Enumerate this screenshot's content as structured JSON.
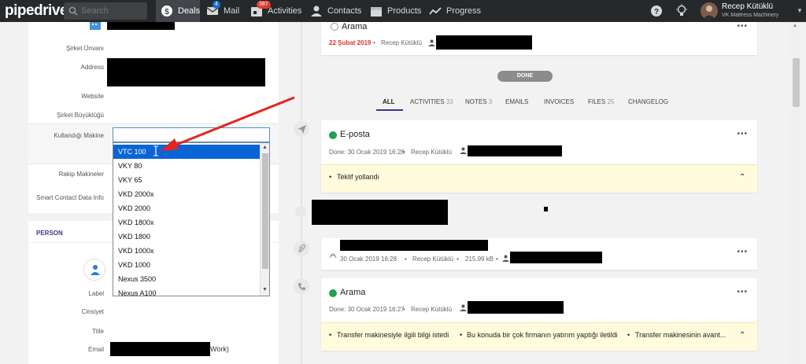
{
  "topbar": {
    "logo": "pipedrive",
    "search_placeholder": "Search",
    "nav": [
      {
        "label": "Deals",
        "icon": "dollar-icon",
        "active": true
      },
      {
        "label": "Mail",
        "icon": "mail-icon",
        "badge": "4"
      },
      {
        "label": "Activities",
        "icon": "calendar-icon",
        "badge": "387"
      },
      {
        "label": "Contacts",
        "icon": "person-icon"
      },
      {
        "label": "Products",
        "icon": "box-icon"
      },
      {
        "label": "Progress",
        "icon": "trend-icon"
      }
    ],
    "user": {
      "name": "Recep Kütüklü",
      "company": "VK Mattress Machinery"
    }
  },
  "left": {
    "fields": [
      {
        "label": "Şirket Ünvanı"
      },
      {
        "label": "Address"
      },
      {
        "label": "Website"
      },
      {
        "label": "Şirket Büyüklüğü"
      },
      {
        "label": "Kullandığı Makine"
      },
      {
        "label": "Rakip Makineler"
      },
      {
        "label": "Smart Contact Data Info"
      }
    ],
    "person_section": "PERSON",
    "person_fields": [
      {
        "label": "Label"
      },
      {
        "label": "Cinsiyet"
      },
      {
        "label": "Title"
      },
      {
        "label": "Email",
        "value_suffix": "Work)"
      }
    ],
    "dropdown": {
      "options": [
        "VTC 100",
        "VKY 80",
        "VKY 65",
        "VKD 2000x",
        "VKD 2000",
        "VKD 1800x",
        "VKD 1800",
        "VKD 1000x",
        "VKD 1000",
        "Nexus 3500",
        "Nexus A100"
      ],
      "selected": "VTC 100"
    }
  },
  "timeline": {
    "top_card": {
      "title": "Arama",
      "date": "22 Şubat 2019",
      "owner": "Recep Kütüklü"
    },
    "done_label": "DONE",
    "tabs": [
      {
        "label": "ALL",
        "active": true
      },
      {
        "label": "ACTIVITIES",
        "count": "33"
      },
      {
        "label": "NOTES",
        "count": "3"
      },
      {
        "label": "EMAILS"
      },
      {
        "label": "INVOICES"
      },
      {
        "label": "FILES",
        "count": "25"
      },
      {
        "label": "CHANGELOG"
      }
    ],
    "email_card": {
      "title": "E-posta",
      "meta": "Done: 30 Ocak 2019 16:28",
      "owner": "Recep Kütüklü",
      "note": "Teklif yollandı"
    },
    "file_card": {
      "meta": "30 Ocak 2019 16:28",
      "owner": "Recep Kütüklü",
      "size": "215.99 kB"
    },
    "call_card": {
      "title": "Arama",
      "meta": "Done: 30 Ocak 2019 16:27",
      "owner": "Recep Kütüklü",
      "notes": [
        "Transfer makinesiyle ilgili bilgi istedi",
        "Bu konuda bir çok firmanın yatırım yaptığı iletildi",
        "Transfer makinesinin avant..."
      ]
    }
  },
  "colors": {
    "topbar": "#26292c",
    "accent": "#4a2e8a",
    "selected": "#0a64d6",
    "overdue": "#d9342b",
    "success": "#1fa34a",
    "note_bg": "#fffbdc"
  }
}
